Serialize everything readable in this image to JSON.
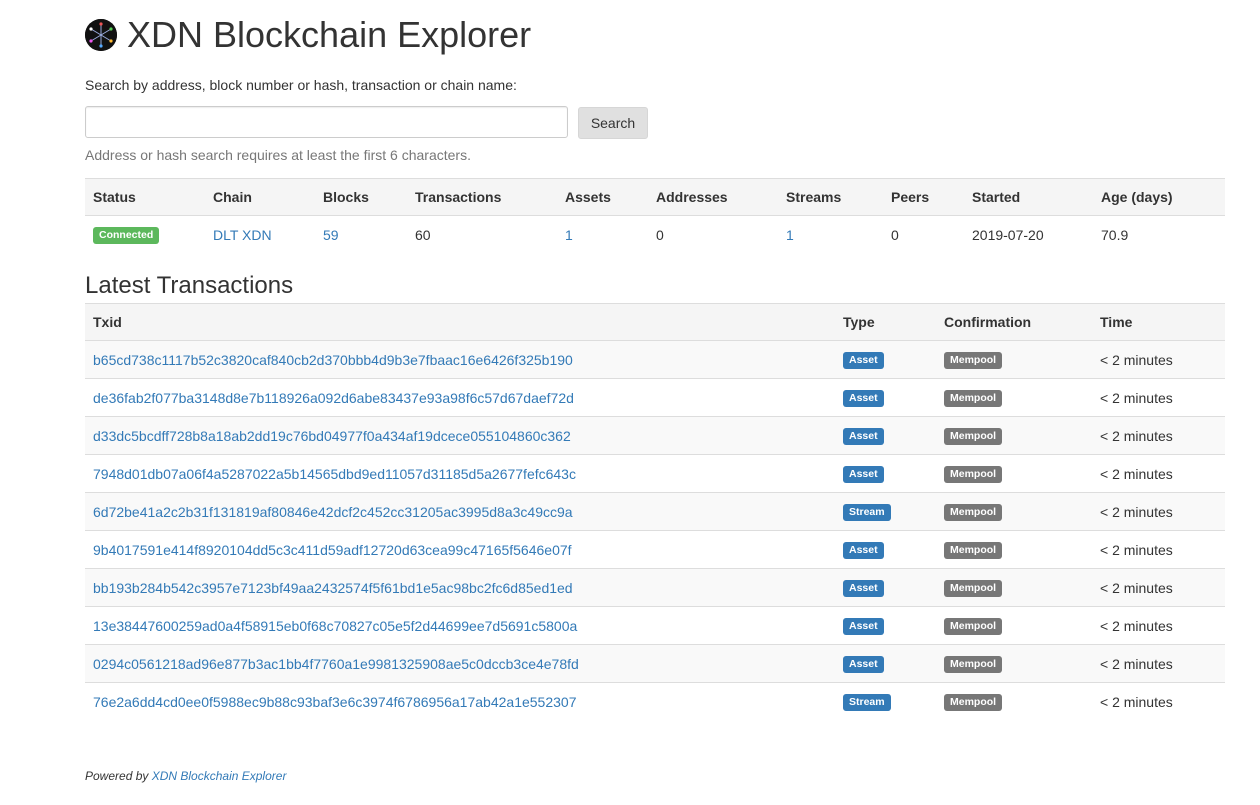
{
  "header": {
    "title": "XDN Blockchain Explorer"
  },
  "search": {
    "label": "Search by address, block number or hash, transaction or chain name:",
    "value": "",
    "placeholder": "",
    "button_label": "Search",
    "hint": "Address or hash search requires at least the first 6 characters."
  },
  "summary": {
    "columns": [
      "Status",
      "Chain",
      "Blocks",
      "Transactions",
      "Assets",
      "Addresses",
      "Streams",
      "Peers",
      "Started",
      "Age (days)"
    ],
    "row": {
      "status": "Connected",
      "chain": "DLT XDN",
      "blocks": "59",
      "transactions": "60",
      "assets": "1",
      "addresses": "0",
      "streams": "1",
      "peers": "0",
      "started": "2019-07-20",
      "age": "70.9"
    }
  },
  "latest": {
    "heading": "Latest Transactions",
    "columns": [
      "Txid",
      "Type",
      "Confirmation",
      "Time"
    ],
    "rows": [
      {
        "txid": "b65cd738c1117b52c3820caf840cb2d370bbb4d9b3e7fbaac16e6426f325b190",
        "type": "Asset",
        "confirmation": "Mempool",
        "time": "< 2 minutes"
      },
      {
        "txid": "de36fab2f077ba3148d8e7b118926a092d6abe83437e93a98f6c57d67daef72d",
        "type": "Asset",
        "confirmation": "Mempool",
        "time": "< 2 minutes"
      },
      {
        "txid": "d33dc5bcdff728b8a18ab2dd19c76bd04977f0a434af19dcece055104860c362",
        "type": "Asset",
        "confirmation": "Mempool",
        "time": "< 2 minutes"
      },
      {
        "txid": "7948d01db07a06f4a5287022a5b14565dbd9ed11057d31185d5a2677fefc643c",
        "type": "Asset",
        "confirmation": "Mempool",
        "time": "< 2 minutes"
      },
      {
        "txid": "6d72be41a2c2b31f131819af80846e42dcf2c452cc31205ac3995d8a3c49cc9a",
        "type": "Stream",
        "confirmation": "Mempool",
        "time": "< 2 minutes"
      },
      {
        "txid": "9b4017591e414f8920104dd5c3c411d59adf12720d63cea99c47165f5646e07f",
        "type": "Asset",
        "confirmation": "Mempool",
        "time": "< 2 minutes"
      },
      {
        "txid": "bb193b284b542c3957e7123bf49aa2432574f5f61bd1e5ac98bc2fc6d85ed1ed",
        "type": "Asset",
        "confirmation": "Mempool",
        "time": "< 2 minutes"
      },
      {
        "txid": "13e38447600259ad0a4f58915eb0f68c70827c05e5f2d44699ee7d5691c5800a",
        "type": "Asset",
        "confirmation": "Mempool",
        "time": "< 2 minutes"
      },
      {
        "txid": "0294c0561218ad96e877b3ac1bb4f7760a1e9981325908ae5c0dccb3ce4e78fd",
        "type": "Asset",
        "confirmation": "Mempool",
        "time": "< 2 minutes"
      },
      {
        "txid": "76e2a6dd4cd0ee0f5988ec9b88c93baf3e6c3974f6786956a17ab42a1e552307",
        "type": "Stream",
        "confirmation": "Mempool",
        "time": "< 2 minutes"
      }
    ]
  },
  "footer": {
    "prefix": "Powered by",
    "link": "XDN Blockchain Explorer"
  },
  "colors": {
    "link": "#337ab7",
    "connected": "#5cb85c",
    "type_badge": "#337ab7",
    "mempool_badge": "#777777"
  },
  "icons": {
    "logo": "xdn-logo-icon"
  }
}
